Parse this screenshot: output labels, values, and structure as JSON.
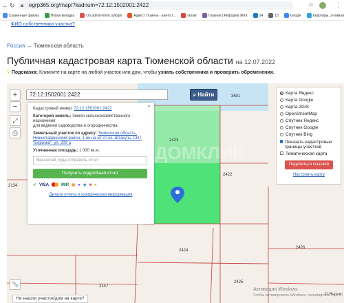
{
  "browser": {
    "url": "egrp365.org/map/?kadnum=72:12:1502001:2422",
    "bookmarks": [
      {
        "label": "Сканенные файлы",
        "color": "#4a8af4"
      },
      {
        "label": "Новая вкладка",
        "color": "#3b9a48"
      },
      {
        "label": "cm.admin-hmm.ru/login",
        "color": "#d9534f"
      },
      {
        "label": "Адвест Тюмень - агентст...",
        "color": "#e05522"
      },
      {
        "label": "Gmail",
        "color": "#d44638"
      },
      {
        "label": "Главная | Реформа ЖКХ",
        "color": "#7b5ea7"
      },
      {
        "label": "24",
        "color": "#1f78c1"
      },
      {
        "label": "13",
        "color": "#666666"
      },
      {
        "label": "Google",
        "color": "#4285f4"
      },
      {
        "label": "Квартиры, 2-комнатн. 62 м² -...",
        "color": "#2aa3e0"
      }
    ]
  },
  "page": {
    "owner_link": "ФИО собственника участка?",
    "breadcrumb": {
      "home": "Россия",
      "sep": "→",
      "current": "Тюменская область"
    },
    "title": "Публичная кадастровая карта Тюменской области",
    "title_date": "на 12.07.2022",
    "hint_label": "Подсказка:",
    "hint_text": "Кликните на карте на любой участок или дом, чтобы",
    "hint_bold": "узнать собственника и проверить обременения."
  },
  "map": {
    "zoom_in": "+",
    "zoom_out": "−",
    "search_value": "72:12:1502001:2422",
    "search_button": "Найти",
    "parcel_labels": [
      "3601",
      "2423",
      "2422",
      "2134",
      "2424",
      "2147",
      "2425",
      "2426"
    ],
    "watermark": "ДОМКЛИК",
    "colors": {
      "selected": "#3ee06c",
      "selected_light": "#a9ecb7",
      "water": "#c7e4f4",
      "line": "#c23b3b"
    }
  },
  "info_panel": {
    "close": "×",
    "cad_label": "Кадастровый номер:",
    "cad_value": "72:12:1502001:2422",
    "category_label": "Категория земель:",
    "category_value": "Земли сельскохозяйственного назначения",
    "purpose_value": "для ведения садоводства и огородничества",
    "address_label": "Земельный участок по адресу:",
    "address_value": "Тюменская область, Нижнетавдинский район, 1 км на юг от оз. Штакуль, СНТ \"Березка\", ул. 209 а",
    "area_label": "Уточненная площадь:",
    "area_value": "1 000 кв.м.",
    "email_placeholder": "Ваш email, куда отправить отчет",
    "report_button": "Получить подробный отчет",
    "payments": [
      "VISA",
      "MIR"
    ],
    "terms_link": "Детали отчета и юридическая информация"
  },
  "layers": {
    "base_options": [
      {
        "label": "Карта Яндекс",
        "selected": true
      },
      {
        "label": "Карта Google",
        "selected": false
      },
      {
        "label": "Карта 2GIS",
        "selected": false
      },
      {
        "label": "OpenStreetMap",
        "selected": false
      },
      {
        "label": "Спутник Яндекс",
        "selected": false
      },
      {
        "label": "Спутник Google",
        "selected": false
      },
      {
        "label": "Спутник Bing",
        "selected": false
      }
    ],
    "show_cad_borders": "Показать кадастровые границы участков",
    "thematic_map": "Тематическая карта",
    "share_button": "Поделиться ссылкой",
    "setup_link": "Настроить карту"
  },
  "bottom": {
    "not_found": "Не нашли участок/дом на карте?",
    "activate_line1": "Активация Windows",
    "activate_line2": "Чтобы активировать Windows, перейдите в",
    "yandex": "© Яндекс"
  }
}
